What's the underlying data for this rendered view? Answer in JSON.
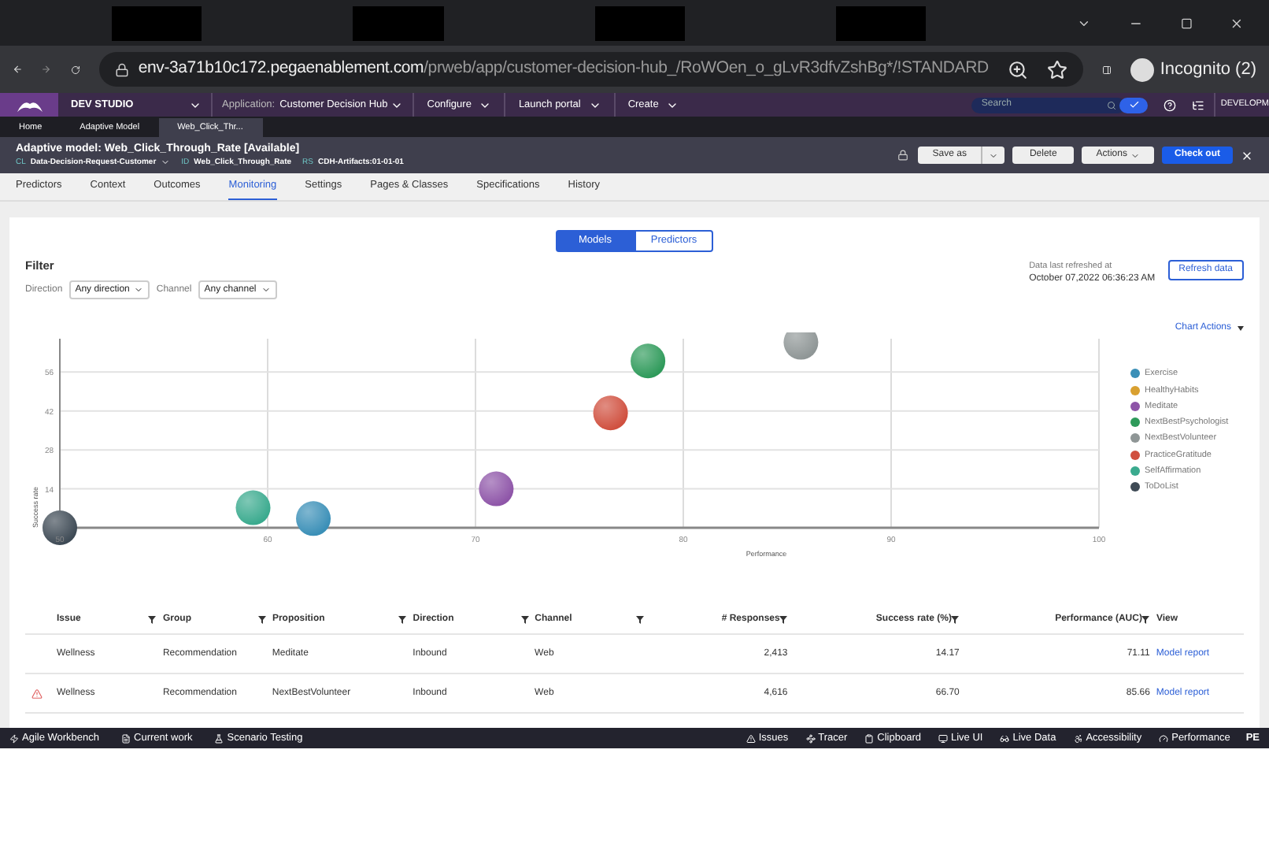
{
  "browser": {
    "address_host": "env-3a71b10c172.pegaenablement.com",
    "address_path": "/prweb/app/customer-decision-hub_/RoWOen_o_gLvR3dfvZshBg*/!STANDARD",
    "profile": "Incognito (2)"
  },
  "header": {
    "studio": "DEV STUDIO",
    "application_label": "Application:",
    "application": "Customer Decision Hub",
    "menus": [
      "Configure",
      "Launch portal",
      "Create"
    ],
    "search": {
      "placeholder": "Search"
    },
    "operator": "DEVELOPM"
  },
  "doc_tabs": [
    {
      "label": "Home",
      "selected": false
    },
    {
      "label": "Adaptive Model",
      "selected": false
    },
    {
      "label": "Web_Click_Thr...",
      "selected": true
    }
  ],
  "record": {
    "title": "Adaptive model: Web_Click_Through_Rate [Available]",
    "meta": [
      {
        "key": "CL",
        "value": "Data-Decision-Request-Customer"
      },
      {
        "key": "ID",
        "value": "Web_Click_Through_Rate"
      },
      {
        "key": "RS",
        "value": "CDH-Artifacts:01-01-01"
      }
    ],
    "buttons": [
      "Save as",
      "Delete",
      "Actions",
      "Check out"
    ]
  },
  "nav_tabs": [
    {
      "label": "Predictors",
      "selected": false
    },
    {
      "label": "Context",
      "selected": false
    },
    {
      "label": "Outcomes",
      "selected": false
    },
    {
      "label": "Monitoring",
      "selected": true
    },
    {
      "label": "Settings",
      "selected": false
    },
    {
      "label": "Pages & Classes",
      "selected": false
    },
    {
      "label": "Specifications",
      "selected": false
    },
    {
      "label": "History",
      "selected": false
    }
  ],
  "view_toggle": [
    {
      "label": "Models",
      "selected": true
    },
    {
      "label": "Predictors",
      "selected": false
    }
  ],
  "filter": {
    "title": "Filter",
    "fields": [
      {
        "label": "Direction",
        "value": "Any direction"
      },
      {
        "label": "Channel",
        "value": "Any channel"
      }
    ]
  },
  "refresh": {
    "label": "Data last refreshed at",
    "time": "October 07,2022 06:36:23 AM",
    "button": "Refresh data"
  },
  "chart_actions": "Chart Actions",
  "chart_data": {
    "type": "scatter",
    "grid": true,
    "legend": "right",
    "xlabel": "Performance",
    "ylabel": "Success rate",
    "xlim": [
      50,
      100
    ],
    "ylim": [
      0,
      68
    ],
    "xticks": [
      50,
      60,
      70,
      80,
      90,
      100
    ],
    "yticks": [
      14,
      28,
      42,
      56
    ],
    "series": [
      {
        "name": "Exercise",
        "color": "#3a8fb7",
        "x": [
          62.2
        ],
        "values": [
          3.3
        ]
      },
      {
        "name": "HealthyHabits",
        "color": "#d9a030"
      },
      {
        "name": "Meditate",
        "color": "#8e55a8",
        "x": [
          71
        ],
        "values": [
          14
        ]
      },
      {
        "name": "NextBestPsychologist",
        "color": "#2e9a5a",
        "x": [
          78.3
        ],
        "values": [
          60
        ]
      },
      {
        "name": "NextBestVolunteer",
        "color": "#8f9696",
        "x": [
          85.66
        ],
        "values": [
          66.7
        ]
      },
      {
        "name": "PracticeGratitude",
        "color": "#d0503f",
        "x": [
          76.5
        ],
        "values": [
          41.3
        ]
      },
      {
        "name": "SelfAffirmation",
        "color": "#3aaa8e",
        "x": [
          59.3
        ],
        "values": [
          7.2
        ]
      },
      {
        "name": "ToDoList",
        "color": "#3e4a55",
        "x": [
          50
        ],
        "values": [
          0
        ]
      }
    ]
  },
  "table": {
    "columns": [
      {
        "label": "Issue",
        "filter": true
      },
      {
        "label": "Group",
        "filter": true
      },
      {
        "label": "Proposition",
        "filter": true
      },
      {
        "label": "Direction",
        "filter": true
      },
      {
        "label": "Channel",
        "filter": true
      },
      {
        "label": "# Responses",
        "filter": true
      },
      {
        "label": "Success rate (%)",
        "filter": true
      },
      {
        "label": "Performance (AUC)",
        "filter": true
      },
      {
        "label": "View",
        "filter": false
      }
    ],
    "rows": [
      {
        "warning": false,
        "cells": [
          "Wellness",
          "Recommendation",
          "Meditate",
          "Inbound",
          "Web",
          "2,413",
          "14.17",
          "71.11"
        ],
        "link": "Model report"
      },
      {
        "warning": true,
        "cells": [
          "Wellness",
          "Recommendation",
          "NextBestVolunteer",
          "Inbound",
          "Web",
          "4,616",
          "66.70",
          "85.66"
        ],
        "link": "Model report"
      }
    ]
  },
  "dev_bar": {
    "left": [
      "Agile Workbench",
      "Current work",
      "Scenario Testing"
    ],
    "right": [
      "Issues",
      "Tracer",
      "Clipboard",
      "Live UI",
      "Live Data",
      "Accessibility",
      "Performance"
    ],
    "cut": "PE"
  }
}
